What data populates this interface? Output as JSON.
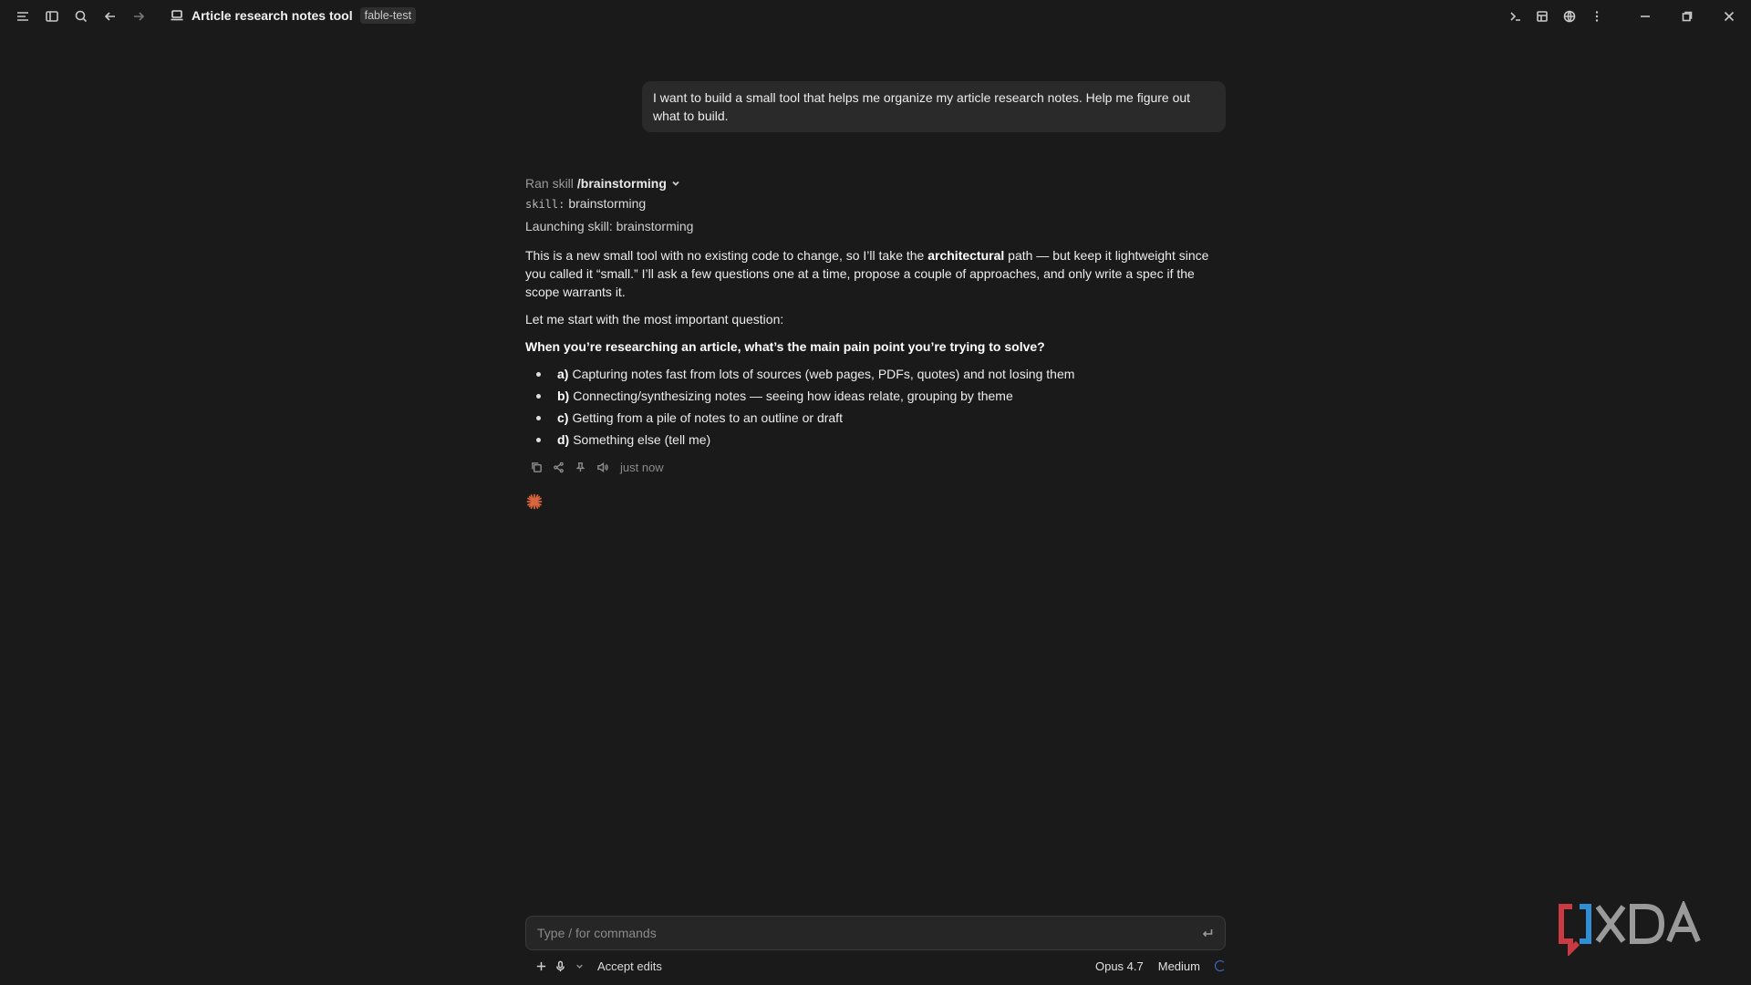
{
  "topbar": {
    "title": "Article research notes tool",
    "tag": "fable-test",
    "icons": [
      "menu-icon",
      "sidebar-icon",
      "search-icon",
      "back-icon",
      "forward-icon",
      "laptop-icon",
      "terminal-icon",
      "panel-icon",
      "globe-icon",
      "more-icon",
      "minimize-icon",
      "restore-icon",
      "close-icon"
    ]
  },
  "user_message": "I want to build a small tool that helps me organize my article research notes. Help me figure out what to build.",
  "assistant": {
    "ran_skill_prefix": "Ran skill",
    "ran_skill_name": "/brainstorming",
    "skill_key": "skill:",
    "skill_value": "brainstorming",
    "launching": "Launching skill: brainstorming",
    "para1_a": "This is a new small tool with no existing code to change, so I’ll take the ",
    "para1_bold": "architectural",
    "para1_b": " path — but keep it lightweight since you called it “small.” I’ll ask a few questions one at a time, propose a couple of approaches, and only write a spec if the scope warrants it.",
    "para2": "Let me start with the most important question:",
    "question": "When you’re researching an article, what’s the main pain point you’re trying to solve?",
    "options": [
      {
        "letter": "a)",
        "text": "Capturing notes fast from lots of sources (web pages, PDFs, quotes) and not losing them"
      },
      {
        "letter": "b)",
        "text": "Connecting/synthesizing notes — seeing how ideas relate, grouping by theme"
      },
      {
        "letter": "c)",
        "text": "Getting from a pile of notes to an outline or draft"
      },
      {
        "letter": "d)",
        "text": "Something else (tell me)"
      }
    ],
    "timestamp": "just now"
  },
  "composer": {
    "placeholder": "Type / for commands",
    "accept_edits": "Accept edits",
    "model": "Opus 4.7",
    "effort": "Medium"
  },
  "colors": {
    "background": "#1a1a1a",
    "bubble": "#2a2a2a",
    "accent_orange": "#d9663c",
    "spinner_blue": "#3d6fd1"
  }
}
